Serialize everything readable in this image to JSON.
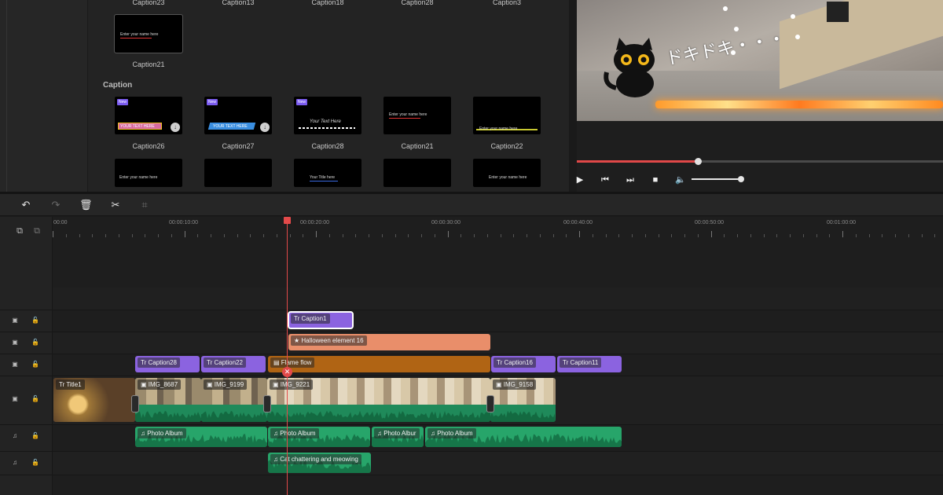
{
  "library": {
    "top_row_labels": [
      "Caption23",
      "Caption13",
      "Caption18",
      "Caption28",
      "Caption3"
    ],
    "single_label": "Caption21",
    "section_title": "Caption",
    "section_items": [
      {
        "label": "Caption26",
        "badge": "New",
        "thumb_text": "YOUR TEXT HERE"
      },
      {
        "label": "Caption27",
        "badge": "New",
        "thumb_text": "YOUR TEXT HERE"
      },
      {
        "label": "Caption28",
        "badge": "New",
        "thumb_text": "Your Text Here"
      },
      {
        "label": "Caption21",
        "badge": "",
        "thumb_text": "Enter your name here"
      },
      {
        "label": "Caption22",
        "badge": "",
        "thumb_text": "Enter your name here"
      }
    ],
    "bottom_row_texts": [
      "Enter your name here",
      "",
      "Your Title here",
      "",
      "Enter your name here"
    ],
    "single_thumb_text": "Enter your name here"
  },
  "preview": {
    "overlay_text": "ドキドキ・・・",
    "progress": 0.33,
    "volume": 0.95,
    "accent": "#e04848"
  },
  "timeline": {
    "ruler_labels": [
      "00:00",
      "00:00:10:00",
      "00:00:20:00",
      "00:00:30:00",
      "00:00:40:00",
      "00:00:50:00",
      "00:01:00:00"
    ],
    "tracks": {
      "caption_top": "Caption1",
      "effect": "Halloween element 16",
      "captions": [
        "Caption28",
        "Caption22",
        "Flame flow",
        "Caption16",
        "Caption11"
      ],
      "video": [
        "Title1",
        "IMG_8687",
        "IMG_9199",
        "IMG_9221",
        "IMG_9158"
      ],
      "audio1": [
        "Photo Album",
        "Photo Album",
        "Photo Albur",
        "Photo Album"
      ],
      "audio2": [
        "Cat chattering and meowing"
      ]
    },
    "colors": {
      "caption": "#8b63e0",
      "effect": "#e98e6a",
      "flame": "#b06414",
      "audio": "#27a56a",
      "playhead": "#e34a4a"
    }
  }
}
